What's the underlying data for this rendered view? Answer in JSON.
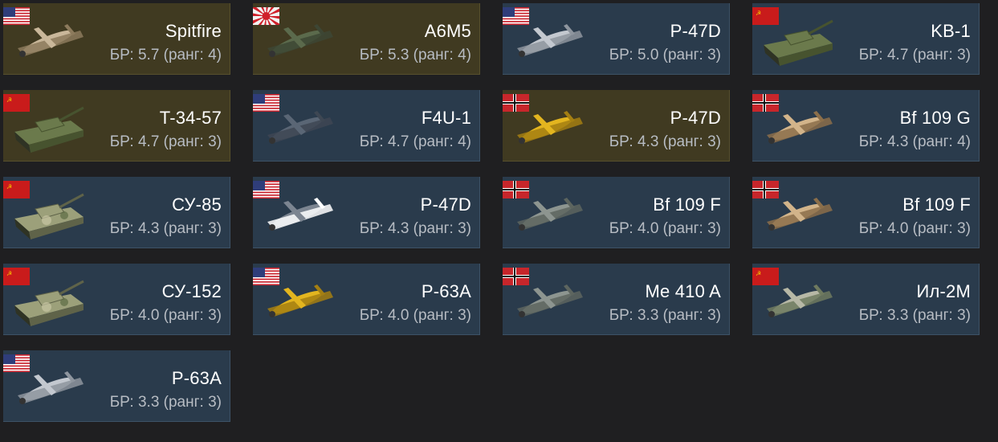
{
  "vehicles": [
    {
      "name": "Spitfire",
      "br": "БР: 5.7 (ранг: 4)",
      "nation": "usa",
      "kind": "plane-tan",
      "style": "premium"
    },
    {
      "name": "A6M5",
      "br": "БР: 5.3 (ранг: 4)",
      "nation": "japan",
      "kind": "plane-green",
      "style": "premium"
    },
    {
      "name": "P-47D",
      "br": "БР: 5.0 (ранг: 3)",
      "nation": "usa",
      "kind": "plane-silver",
      "style": "normal"
    },
    {
      "name": "KB-1",
      "br": "БР: 4.7 (ранг: 3)",
      "nation": "ussr",
      "kind": "tank-green",
      "style": "normal"
    },
    {
      "name": "T-34-57",
      "br": "БР: 4.7 (ранг: 3)",
      "nation": "ussr",
      "kind": "tank-green",
      "style": "premium"
    },
    {
      "name": "F4U-1",
      "br": "БР: 4.7 (ранг: 4)",
      "nation": "usa",
      "kind": "plane-blue",
      "style": "normal"
    },
    {
      "name": "P-47D",
      "br": "БР: 4.3 (ранг: 3)",
      "nation": "germany",
      "kind": "plane-yellow",
      "style": "premium"
    },
    {
      "name": "Bf 109 G",
      "br": "БР: 4.3 (ранг: 4)",
      "nation": "germany",
      "kind": "plane-desert",
      "style": "normal"
    },
    {
      "name": "СУ-85",
      "br": "БР: 4.3 (ранг: 3)",
      "nation": "ussr",
      "kind": "tank-camo",
      "style": "normal"
    },
    {
      "name": "P-47D",
      "br": "БР: 4.3 (ранг: 3)",
      "nation": "usa",
      "kind": "plane-stripes",
      "style": "normal"
    },
    {
      "name": "Bf 109 F",
      "br": "БР: 4.0 (ранг: 3)",
      "nation": "germany",
      "kind": "plane-gray",
      "style": "normal"
    },
    {
      "name": "Bf 109 F",
      "br": "БР: 4.0 (ранг: 3)",
      "nation": "germany",
      "kind": "plane-desert",
      "style": "normal"
    },
    {
      "name": "СУ-152",
      "br": "БР: 4.0 (ранг: 3)",
      "nation": "ussr",
      "kind": "tank-camo",
      "style": "normal"
    },
    {
      "name": "P-63A",
      "br": "БР: 4.0 (ранг: 3)",
      "nation": "usa",
      "kind": "plane-yellow",
      "style": "normal"
    },
    {
      "name": "Me 410 A",
      "br": "БР: 3.3 (ранг: 3)",
      "nation": "germany",
      "kind": "plane-gray",
      "style": "normal"
    },
    {
      "name": "Ил-2М",
      "br": "БР: 3.3 (ранг: 3)",
      "nation": "ussr",
      "kind": "plane-camo",
      "style": "normal"
    },
    {
      "name": "P-63A",
      "br": "БР: 3.3 (ранг: 3)",
      "nation": "usa",
      "kind": "plane-silver",
      "style": "normal"
    }
  ]
}
